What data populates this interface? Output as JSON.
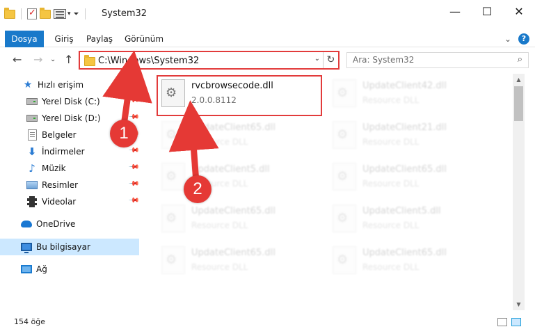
{
  "window": {
    "title": "System32",
    "minimize": "—",
    "maximize": "☐",
    "close": "✕"
  },
  "ribbon": {
    "tabs": [
      "Dosya",
      "Giriş",
      "Paylaş",
      "Görünüm"
    ],
    "expand": "⌄",
    "help": "?"
  },
  "nav": {
    "back": "←",
    "forward": "→",
    "recent": "⌄",
    "up": "↑",
    "address": "C:\\Windows\\System32",
    "address_dropdown": "⌄",
    "refresh": "↻",
    "search_placeholder": "Ara: System32"
  },
  "sidebar": {
    "items": [
      {
        "label": "Hızlı erişim",
        "icon": "star-icon"
      },
      {
        "label": "Yerel Disk (C:)",
        "icon": "drive-icon",
        "pinned": true
      },
      {
        "label": "Yerel Disk (D:)",
        "icon": "drive-icon",
        "pinned": true
      },
      {
        "label": "Belgeler",
        "icon": "document-icon",
        "pinned": true
      },
      {
        "label": "İndirmeler",
        "icon": "download-icon",
        "pinned": true
      },
      {
        "label": "Müzik",
        "icon": "music-icon",
        "pinned": true
      },
      {
        "label": "Resimler",
        "icon": "pictures-icon",
        "pinned": true
      },
      {
        "label": "Videolar",
        "icon": "video-icon",
        "pinned": true
      },
      {
        "label": "OneDrive",
        "icon": "onedrive-icon"
      },
      {
        "label": "Bu bilgisayar",
        "icon": "computer-icon",
        "selected": true
      },
      {
        "label": "Ağ",
        "icon": "network-icon"
      }
    ]
  },
  "files": [
    {
      "name": "rvcbrowsecode.dll",
      "sub": "2.0.0.8112",
      "highlighted": true
    },
    {
      "name": "UpdateClient42.dll",
      "sub": "Resource DLL"
    },
    {
      "name": "UpdateClient65.dll",
      "sub": "Resource DLL"
    },
    {
      "name": "UpdateClient21.dll",
      "sub": "Resource DLL"
    },
    {
      "name": "UpdateClient5.dll",
      "sub": "Resource DLL"
    },
    {
      "name": "UpdateClient65.dll",
      "sub": "Resource DLL"
    },
    {
      "name": "UpdateClient65.dll",
      "sub": "Resource DLL"
    },
    {
      "name": "UpdateClient5.dll",
      "sub": "Resource DLL"
    },
    {
      "name": "UpdateClient65.dll",
      "sub": "Resource DLL"
    },
    {
      "name": "UpdateClient65.dll",
      "sub": "Resource DLL"
    }
  ],
  "status": {
    "count": "154 öğe"
  },
  "annotations": {
    "step1": "1",
    "step2": "2",
    "color": "#e53935"
  },
  "colors": {
    "accent": "#1979ca",
    "highlight_border": "#e23b3b",
    "selected_bg": "#cce8ff"
  }
}
